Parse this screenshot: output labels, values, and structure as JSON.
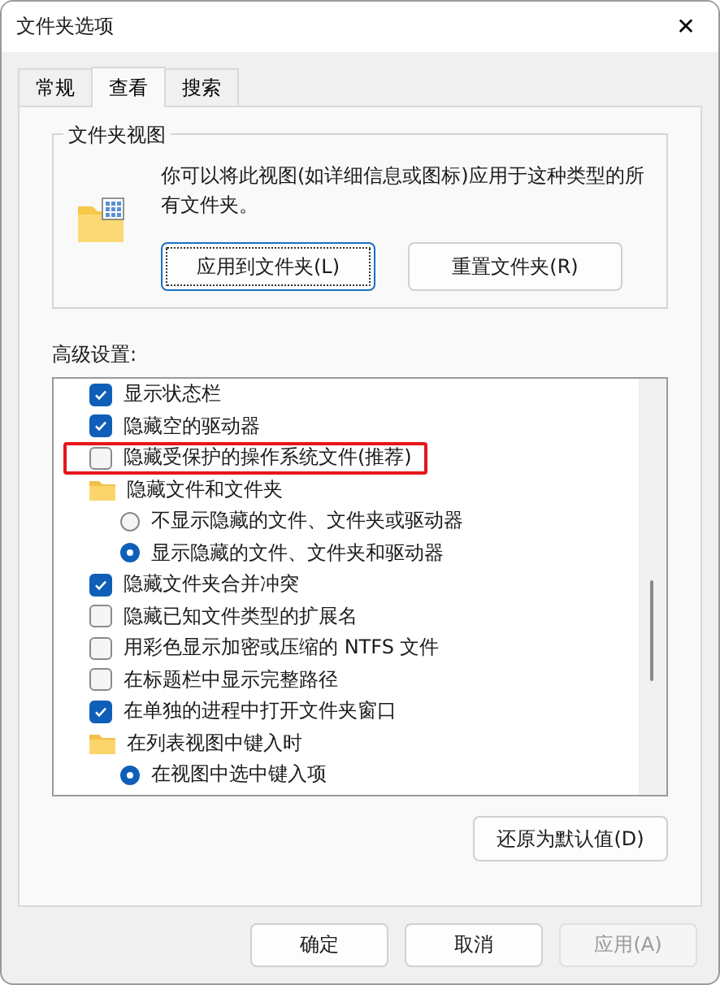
{
  "window": {
    "title": "文件夹选项",
    "close": "✕"
  },
  "tabs": [
    {
      "label": "常规",
      "selected": false
    },
    {
      "label": "查看",
      "selected": true
    },
    {
      "label": "搜索",
      "selected": false
    }
  ],
  "folder_views": {
    "legend": "文件夹视图",
    "description": "你可以将此视图(如详细信息或图标)应用于这种类型的所有文件夹。",
    "buttons": [
      {
        "label": "应用到文件夹(L)",
        "focused": true
      },
      {
        "label": "重置文件夹(R)",
        "focused": false
      }
    ]
  },
  "advanced": {
    "label": "高级设置:",
    "items": [
      {
        "kind": "checkbox",
        "label": "显示状态栏",
        "checked": true,
        "highlighted": false
      },
      {
        "kind": "checkbox",
        "label": "隐藏空的驱动器",
        "checked": true,
        "highlighted": false
      },
      {
        "kind": "checkbox",
        "label": "隐藏受保护的操作系统文件(推荐)",
        "checked": false,
        "highlighted": true
      },
      {
        "kind": "folder",
        "label": "隐藏文件和文件夹",
        "highlighted": false,
        "children": [
          {
            "kind": "radio",
            "label": "不显示隐藏的文件、文件夹或驱动器",
            "selected": false
          },
          {
            "kind": "radio",
            "label": "显示隐藏的文件、文件夹和驱动器",
            "selected": true
          }
        ]
      },
      {
        "kind": "checkbox",
        "label": "隐藏文件夹合并冲突",
        "checked": true,
        "highlighted": false
      },
      {
        "kind": "checkbox",
        "label": "隐藏已知文件类型的扩展名",
        "checked": false,
        "highlighted": false
      },
      {
        "kind": "checkbox",
        "label": "用彩色显示加密或压缩的 NTFS 文件",
        "checked": false,
        "highlighted": false
      },
      {
        "kind": "checkbox",
        "label": "在标题栏中显示完整路径",
        "checked": false,
        "highlighted": false
      },
      {
        "kind": "checkbox",
        "label": "在单独的进程中打开文件夹窗口",
        "checked": true,
        "highlighted": false
      },
      {
        "kind": "folder",
        "label": "在列表视图中键入时",
        "highlighted": false,
        "children": [
          {
            "kind": "radio",
            "label": "在视图中选中键入项",
            "selected": true
          }
        ]
      }
    ],
    "restore_button": "还原为默认值(D)"
  },
  "buttons": [
    {
      "label": "确定",
      "disabled": false
    },
    {
      "label": "取消",
      "disabled": false
    },
    {
      "label": "应用(A)",
      "disabled": true
    }
  ]
}
